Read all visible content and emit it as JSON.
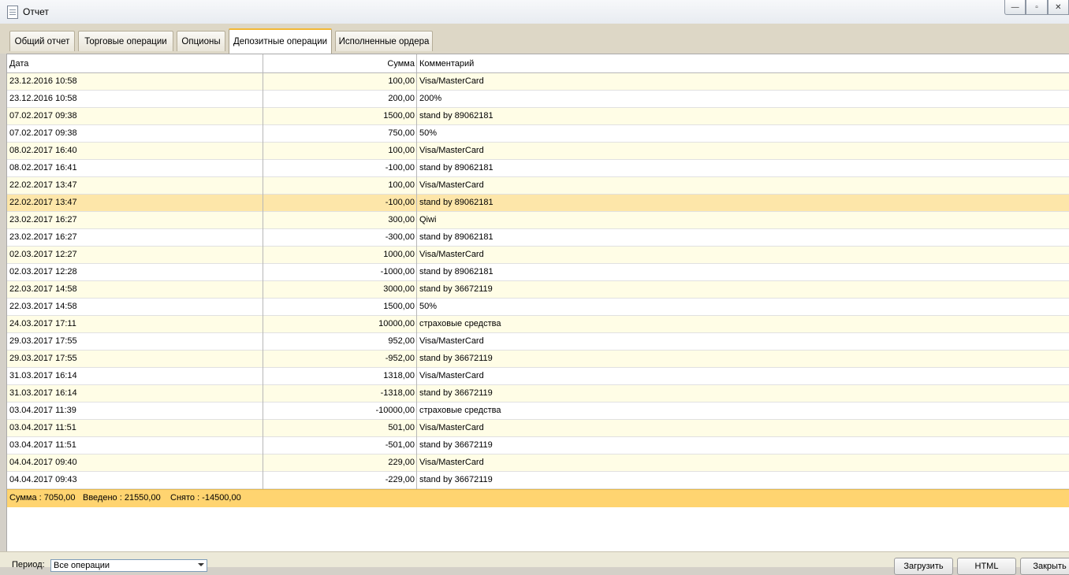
{
  "window": {
    "title": "Отчет"
  },
  "tabs": [
    {
      "label": "Общий отчет",
      "active": false
    },
    {
      "label": "Торговые операции",
      "active": false
    },
    {
      "label": "Опционы",
      "active": false
    },
    {
      "label": "Депозитные операции",
      "active": true
    },
    {
      "label": "Исполненные ордера",
      "active": false
    }
  ],
  "table": {
    "columns": {
      "date": "Дата",
      "sum": "Сумма",
      "comment": "Комментарий"
    },
    "rows": [
      {
        "date": "23.12.2016 10:58",
        "sum": "100,00",
        "comment": "Visa/MasterCard"
      },
      {
        "date": "23.12.2016 10:58",
        "sum": "200,00",
        "comment": "200%"
      },
      {
        "date": "07.02.2017 09:38",
        "sum": "1500,00",
        "comment": "stand by 89062181"
      },
      {
        "date": "07.02.2017 09:38",
        "sum": "750,00",
        "comment": "50%"
      },
      {
        "date": "08.02.2017 16:40",
        "sum": "100,00",
        "comment": "Visa/MasterCard"
      },
      {
        "date": "08.02.2017 16:41",
        "sum": "-100,00",
        "comment": "stand by 89062181"
      },
      {
        "date": "22.02.2017 13:47",
        "sum": "100,00",
        "comment": "Visa/MasterCard"
      },
      {
        "date": "22.02.2017 13:47",
        "sum": "-100,00",
        "comment": "stand by 89062181",
        "selected": true
      },
      {
        "date": "23.02.2017 16:27",
        "sum": "300,00",
        "comment": "Qiwi"
      },
      {
        "date": "23.02.2017 16:27",
        "sum": "-300,00",
        "comment": "stand by 89062181"
      },
      {
        "date": "02.03.2017 12:27",
        "sum": "1000,00",
        "comment": "Visa/MasterCard"
      },
      {
        "date": "02.03.2017 12:28",
        "sum": "-1000,00",
        "comment": "stand by 89062181"
      },
      {
        "date": "22.03.2017 14:58",
        "sum": "3000,00",
        "comment": "stand by 36672119"
      },
      {
        "date": "22.03.2017 14:58",
        "sum": "1500,00",
        "comment": "50%"
      },
      {
        "date": "24.03.2017 17:11",
        "sum": "10000,00",
        "comment": "страховые средства"
      },
      {
        "date": "29.03.2017 17:55",
        "sum": "952,00",
        "comment": "Visa/MasterCard"
      },
      {
        "date": "29.03.2017 17:55",
        "sum": "-952,00",
        "comment": "stand by 36672119"
      },
      {
        "date": "31.03.2017 16:14",
        "sum": "1318,00",
        "comment": "Visa/MasterCard"
      },
      {
        "date": "31.03.2017 16:14",
        "sum": "-1318,00",
        "comment": "stand by 36672119"
      },
      {
        "date": "03.04.2017 11:39",
        "sum": "-10000,00",
        "comment": "страховые средства"
      },
      {
        "date": "03.04.2017 11:51",
        "sum": "501,00",
        "comment": "Visa/MasterCard"
      },
      {
        "date": "03.04.2017 11:51",
        "sum": "-501,00",
        "comment": "stand by 36672119"
      },
      {
        "date": "04.04.2017 09:40",
        "sum": "229,00",
        "comment": "Visa/MasterCard"
      },
      {
        "date": "04.04.2017 09:43",
        "sum": "-229,00",
        "comment": "stand by 36672119"
      }
    ],
    "footer": {
      "total": "Сумма : 7050,00",
      "deposited": "Введено : 21550,00",
      "withdrawn": "Снято : -14500,00"
    }
  },
  "bottom": {
    "period_label": "Период:",
    "period_value": "Все операции",
    "load_button": "Загрузить",
    "html_button": "HTML",
    "close_button": "Закрыть"
  },
  "colors": {
    "row_alt": "#fffde6",
    "row_selected": "#fde6a9",
    "footer": "#ffd470",
    "active_tab_accent": "#f2b835"
  }
}
